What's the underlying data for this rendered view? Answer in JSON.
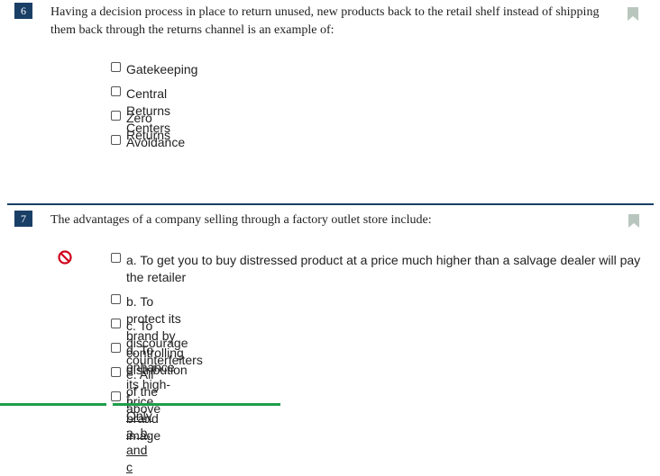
{
  "questions": [
    {
      "number": "6",
      "text": "Having a decision process in place to return unused, new products back to the retail shelf instead of shipping them back through the returns channel is an example of:",
      "options": [
        "Gatekeeping",
        "Central Returns Centers",
        "Zero Returns",
        "Avoidance"
      ]
    },
    {
      "number": "7",
      "text": "The advantages of a company selling through a factory outlet store include:",
      "options": [
        "a. To get you to buy distressed product at a price much higher than a salvage dealer will pay the retailer",
        "b. To protect its brand by controlling distribution",
        "c. To discourage counterfeiters",
        "d. To enhance its high-price brand image",
        "e. All of the above",
        "f. Only a, b, and c"
      ],
      "status_icon": "prohibited-icon"
    }
  ],
  "colors": {
    "number_bg": "#1a3f66",
    "divider": "#1a3f66",
    "bookmark": "#b9c6bd",
    "prohibited": "#d0021b",
    "bottom_bar": "#1e9e4a"
  }
}
